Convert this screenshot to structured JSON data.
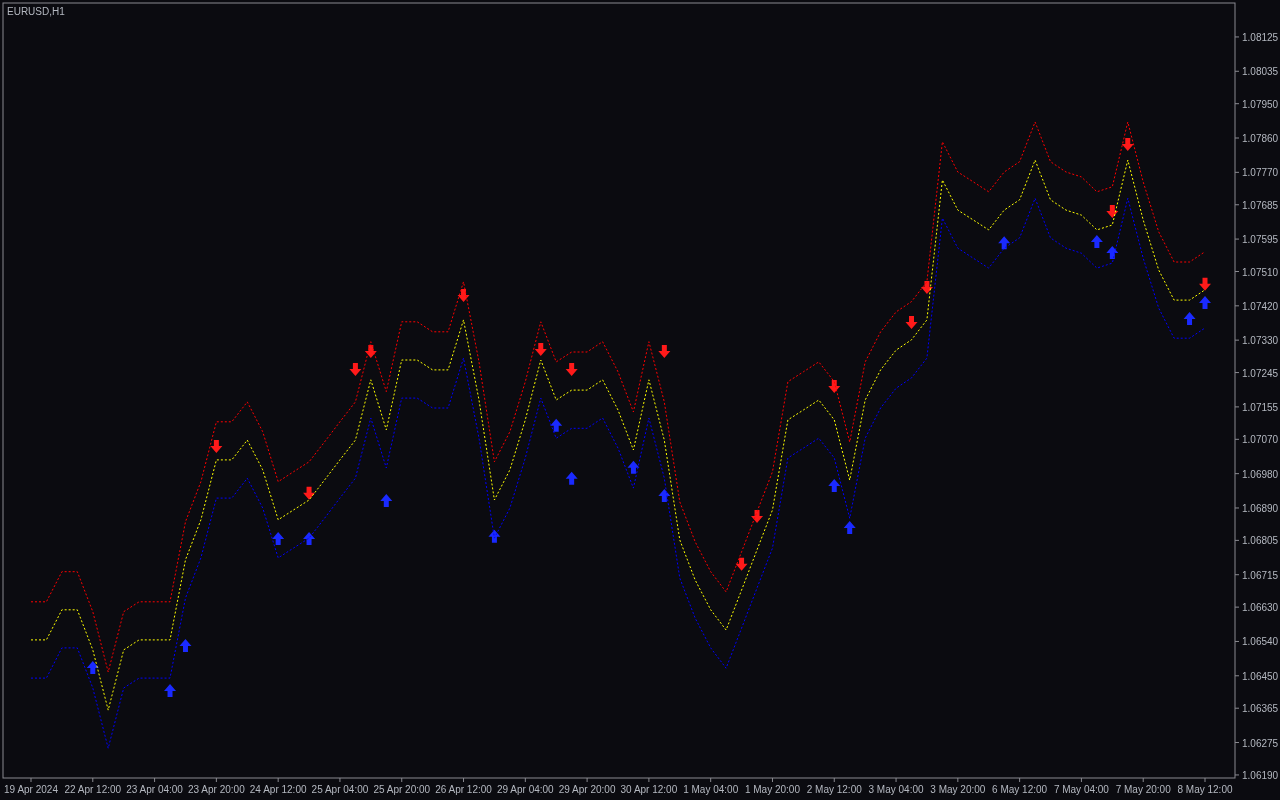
{
  "chart": {
    "chart_data": {
      "type": "line",
      "title": "EURUSD,H1",
      "categories": [
        "19 Apr 2024",
        null,
        null,
        null,
        "22 Apr 12:00",
        null,
        null,
        null,
        "23 Apr 04:00",
        null,
        null,
        null,
        "23 Apr 20:00",
        null,
        null,
        null,
        "24 Apr 12:00",
        null,
        null,
        null,
        "25 Apr 04:00",
        null,
        null,
        null,
        "25 Apr 20:00",
        null,
        null,
        null,
        "26 Apr 12:00",
        null,
        null,
        null,
        "29 Apr 04:00",
        null,
        null,
        null,
        "29 Apr 20:00",
        null,
        null,
        null,
        "30 Apr 12:00",
        null,
        null,
        null,
        "1 May 04:00",
        null,
        null,
        null,
        "1 May 20:00",
        null,
        null,
        null,
        "2 May 12:00",
        null,
        null,
        null,
        "3 May 04:00",
        null,
        null,
        null,
        "3 May 20:00",
        null,
        null,
        null,
        "6 May 12:00",
        null,
        null,
        null,
        "7 May 04:00",
        null,
        null,
        null,
        "7 May 20:00",
        null,
        null,
        null,
        "8 May 12:00"
      ],
      "series": [
        {
          "color": "#ff0000",
          "line_style": "dashed",
          "values": [
            1.06644,
            1.06644,
            1.06723,
            1.06723,
            1.06618,
            1.0646,
            1.06618,
            1.06644,
            1.06644,
            1.06644,
            1.06854,
            1.06959,
            1.07116,
            1.07116,
            1.07168,
            1.0709,
            1.06959,
            1.06985,
            1.07011,
            1.07063,
            1.07116,
            1.07168,
            1.07326,
            1.07195,
            1.07378,
            1.07378,
            1.07352,
            1.07352,
            1.07483,
            1.07273,
            1.07011,
            1.0709,
            1.07221,
            1.07378,
            1.07273,
            1.07299,
            1.07299,
            1.07326,
            1.07247,
            1.07142,
            1.07326,
            1.07168,
            1.06906,
            1.06801,
            1.06723,
            1.0667,
            1.06775,
            1.0688,
            1.06985,
            1.07221,
            1.07247,
            1.07273,
            1.07221,
            1.07063,
            1.07273,
            1.07352,
            1.07404,
            1.07431,
            1.07483,
            1.0785,
            1.07771,
            1.07745,
            1.07719,
            1.07771,
            1.07798,
            1.07902,
            1.07798,
            1.07771,
            1.07758,
            1.07719,
            1.07732,
            1.07902,
            1.07745,
            1.07614,
            1.07535,
            1.07535,
            1.07562
          ]
        },
        {
          "color": "#ffff00",
          "line_style": "dashed",
          "values": [
            1.06544,
            1.06544,
            1.06623,
            1.06623,
            1.06518,
            1.0636,
            1.06518,
            1.06544,
            1.06544,
            1.06544,
            1.06754,
            1.06859,
            1.07016,
            1.07016,
            1.07068,
            1.0699,
            1.06859,
            1.06885,
            1.06911,
            1.06963,
            1.07016,
            1.07068,
            1.07226,
            1.07095,
            1.07278,
            1.07278,
            1.07252,
            1.07252,
            1.07383,
            1.07173,
            1.06911,
            1.0699,
            1.07121,
            1.07278,
            1.07173,
            1.07199,
            1.07199,
            1.07226,
            1.07147,
            1.07042,
            1.07226,
            1.07068,
            1.06806,
            1.06701,
            1.06623,
            1.0657,
            1.06675,
            1.0678,
            1.06885,
            1.07121,
            1.07147,
            1.07173,
            1.07121,
            1.06963,
            1.07173,
            1.07252,
            1.07304,
            1.07331,
            1.07383,
            1.0775,
            1.07671,
            1.07645,
            1.07619,
            1.07671,
            1.07698,
            1.07802,
            1.07698,
            1.07671,
            1.07658,
            1.07619,
            1.07632,
            1.07802,
            1.07645,
            1.07514,
            1.07435,
            1.07435,
            1.07462
          ]
        },
        {
          "color": "#0000ff",
          "line_style": "dashed",
          "values": [
            1.06444,
            1.06444,
            1.06523,
            1.06523,
            1.06418,
            1.0626,
            1.06418,
            1.06444,
            1.06444,
            1.06444,
            1.06654,
            1.06759,
            1.06916,
            1.06916,
            1.06968,
            1.0689,
            1.06759,
            1.06785,
            1.06811,
            1.06863,
            1.06916,
            1.06968,
            1.07126,
            1.06995,
            1.07178,
            1.07178,
            1.07152,
            1.07152,
            1.07283,
            1.07073,
            1.06811,
            1.0689,
            1.07021,
            1.07178,
            1.07073,
            1.07099,
            1.07099,
            1.07126,
            1.07047,
            1.06942,
            1.07126,
            1.06968,
            1.06706,
            1.06601,
            1.06523,
            1.0647,
            1.06575,
            1.0668,
            1.06785,
            1.07021,
            1.07047,
            1.07073,
            1.07021,
            1.06863,
            1.07073,
            1.07152,
            1.07204,
            1.07231,
            1.07283,
            1.0765,
            1.07571,
            1.07545,
            1.07519,
            1.07571,
            1.07598,
            1.07702,
            1.07598,
            1.07571,
            1.07558,
            1.07519,
            1.07532,
            1.07702,
            1.07545,
            1.07414,
            1.07335,
            1.07335,
            1.07362
          ]
        },
        {
          "type": "scatter",
          "color": "#ff1a1a",
          "marker": "triangle",
          "values": [
            null,
            null,
            null,
            null,
            null,
            null,
            null,
            null,
            null,
            null,
            null,
            null,
            1.0705,
            null,
            null,
            null,
            null,
            null,
            1.06927,
            null,
            null,
            1.07252,
            1.07299,
            null,
            null,
            null,
            null,
            null,
            1.07446,
            null,
            null,
            null,
            null,
            1.07304,
            null,
            1.07252,
            null,
            null,
            null,
            null,
            null,
            1.07299,
            null,
            null,
            null,
            null,
            1.06741,
            1.06866,
            null,
            null,
            null,
            null,
            1.07207,
            null,
            null,
            null,
            null,
            1.07375,
            1.07467,
            null,
            null,
            null,
            null,
            null,
            null,
            null,
            null,
            null,
            null,
            null,
            1.07666,
            1.07842,
            null,
            null,
            null,
            null,
            1.07475
          ]
        },
        {
          "type": "scatter",
          "color": "#1a2aff",
          "marker": "triangle",
          "values": [
            null,
            null,
            null,
            null,
            1.06473,
            null,
            null,
            null,
            null,
            1.06413,
            1.06531,
            null,
            null,
            null,
            null,
            null,
            1.06811,
            null,
            1.06811,
            null,
            null,
            null,
            null,
            1.06911,
            null,
            null,
            null,
            null,
            null,
            null,
            1.06817,
            null,
            null,
            null,
            1.07108,
            1.06969,
            null,
            null,
            null,
            1.06998,
            null,
            1.06924,
            null,
            null,
            null,
            null,
            null,
            null,
            null,
            null,
            null,
            null,
            1.0695,
            1.0684,
            null,
            null,
            null,
            null,
            null,
            null,
            null,
            null,
            null,
            1.07587,
            null,
            null,
            null,
            null,
            null,
            1.0759,
            1.07561,
            null,
            null,
            null,
            null,
            1.07388,
            1.0743
          ]
        }
      ],
      "ylim": [
        1.06182,
        1.08214
      ],
      "yticks": [
        {
          "value": 1.08125,
          "label": "1.08125"
        },
        {
          "value": 1.08035,
          "label": "1.08035"
        },
        {
          "value": 1.0795,
          "label": "1.07950"
        },
        {
          "value": 1.0786,
          "label": "1.07860"
        },
        {
          "value": 1.0777,
          "label": "1.07770"
        },
        {
          "value": 1.07685,
          "label": "1.07685"
        },
        {
          "value": 1.07595,
          "label": "1.07595"
        },
        {
          "value": 1.0751,
          "label": "1.07510"
        },
        {
          "value": 1.0742,
          "label": "1.07420"
        },
        {
          "value": 1.0733,
          "label": "1.07330"
        },
        {
          "value": 1.07245,
          "label": "1.07245"
        },
        {
          "value": 1.07155,
          "label": "1.07155"
        },
        {
          "value": 1.0707,
          "label": "1.07070"
        },
        {
          "value": 1.0698,
          "label": "1.06980"
        },
        {
          "value": 1.0689,
          "label": "1.06890"
        },
        {
          "value": 1.06805,
          "label": "1.06805"
        },
        {
          "value": 1.06715,
          "label": "1.06715"
        },
        {
          "value": 1.0663,
          "label": "1.06630"
        },
        {
          "value": 1.0654,
          "label": "1.06540"
        },
        {
          "value": 1.0645,
          "label": "1.06450"
        },
        {
          "value": 1.06365,
          "label": "1.06365"
        },
        {
          "value": 1.06275,
          "label": "1.06275"
        },
        {
          "value": 1.0619,
          "label": "1.06190"
        }
      ]
    }
  }
}
